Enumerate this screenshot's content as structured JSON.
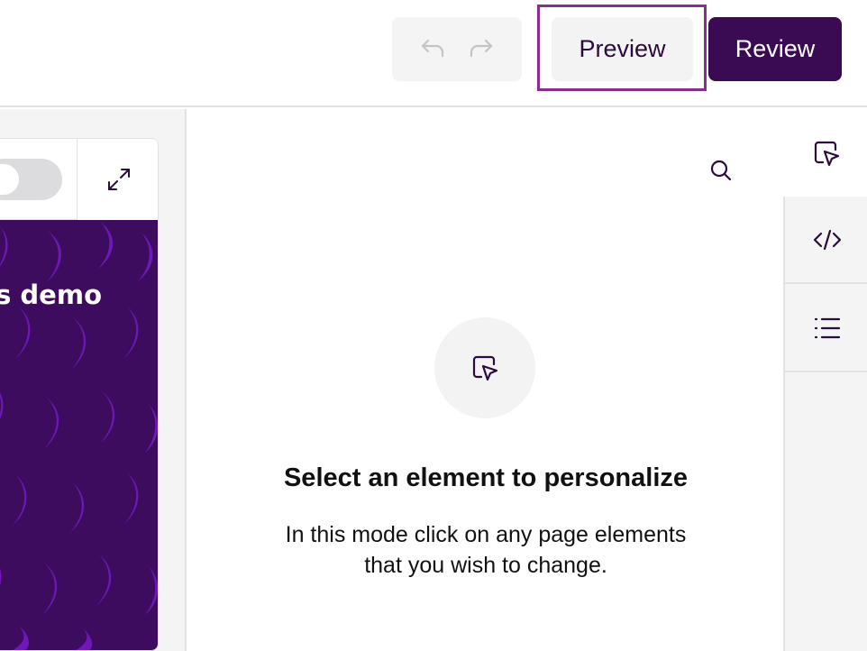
{
  "toolbar": {
    "undo_icon": "undo-icon",
    "redo_icon": "redo-icon",
    "preview_label": "Preview",
    "review_label": "Review",
    "highlight_color": "#8a2c91",
    "review_bg": "#3a0b52"
  },
  "canvas": {
    "hero_title": "s demo",
    "hero_bg": "#3d0c5e",
    "pattern_color": "#6e18b8"
  },
  "panel": {
    "empty_title": "Select an element to personalize",
    "empty_desc_line1": "In this mode click on any page elements",
    "empty_desc_line2": "that you wish to change."
  },
  "sidebar": {
    "tabs": [
      {
        "icon": "cursor-select-icon",
        "active": true
      },
      {
        "icon": "code-icon",
        "active": false
      },
      {
        "icon": "list-icon",
        "active": false
      }
    ]
  }
}
